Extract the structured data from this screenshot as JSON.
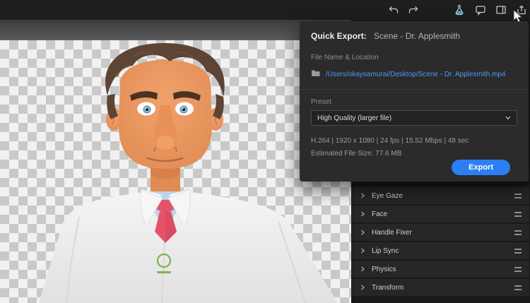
{
  "toolbar": {
    "icons": [
      "undo",
      "redo",
      "characterizer-flask",
      "comments",
      "workspace-panel",
      "share-export"
    ]
  },
  "quick_export": {
    "title": "Quick Export:",
    "scene_name": "Scene - Dr. Applesmith",
    "file_location_label": "File Name & Location",
    "file_path": "/Users/okaysamurai/Desktop/Scene - Dr. Applesmith.mp4",
    "preset_label": "Preset",
    "preset_value": "High Quality (larger file)",
    "video_info": "H.264 | 1920 x 1080 | 24 fps | 15.52 Mbps | 48 sec",
    "estimated_size": "Estimated File Size: 77.6 MB",
    "export_button": "Export"
  },
  "properties_panel": {
    "rows": [
      {
        "label": "Eye Gaze"
      },
      {
        "label": "Face"
      },
      {
        "label": "Handle Fixer"
      },
      {
        "label": "Lip Sync"
      },
      {
        "label": "Physics"
      },
      {
        "label": "Transform"
      }
    ]
  },
  "colors": {
    "accent_blue": "#2b7ff2",
    "link_blue": "#4a9bf5",
    "popup_bg": "#2b2b2b"
  }
}
